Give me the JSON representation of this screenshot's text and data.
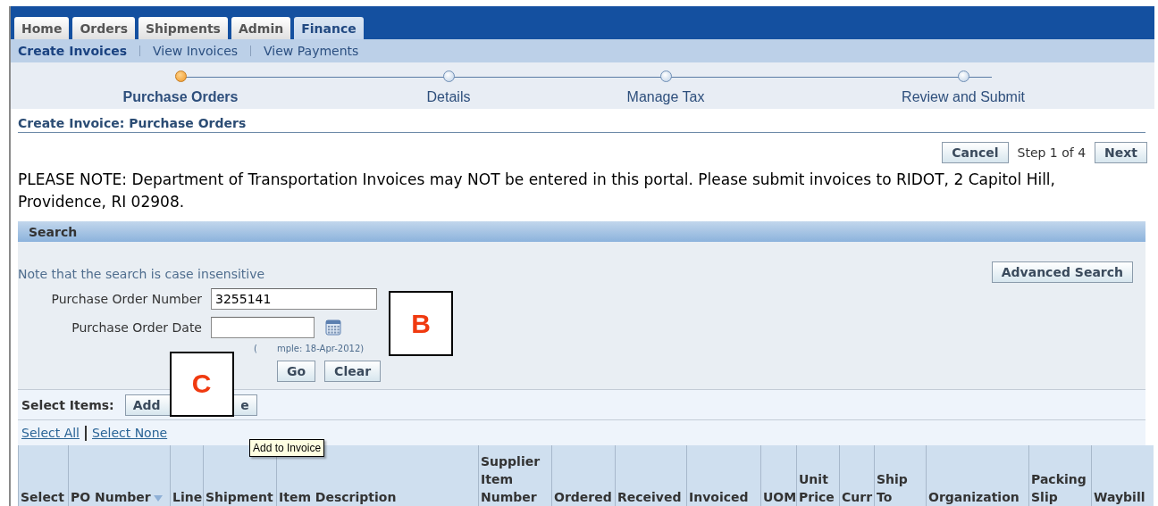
{
  "tabs": [
    {
      "label": "Home",
      "selected": false
    },
    {
      "label": "Orders",
      "selected": false
    },
    {
      "label": "Shipments",
      "selected": false
    },
    {
      "label": "Admin",
      "selected": false
    },
    {
      "label": "Finance",
      "selected": true
    }
  ],
  "subnav": [
    {
      "label": "Create Invoices",
      "selected": true
    },
    {
      "label": "View Invoices",
      "selected": false
    },
    {
      "label": "View Payments",
      "selected": false
    }
  ],
  "train": [
    {
      "label": "Purchase Orders",
      "selected": true
    },
    {
      "label": "Details",
      "selected": false
    },
    {
      "label": "Manage Tax",
      "selected": false
    },
    {
      "label": "Review and Submit",
      "selected": false
    }
  ],
  "page_title": "Create Invoice: Purchase Orders",
  "actions": {
    "cancel": "Cancel",
    "step": "Step 1 of 4",
    "next": "Next"
  },
  "notice": "PLEASE NOTE: Department of Transportation Invoices may NOT be entered in this portal. Please submit invoices to RIDOT, 2 Capitol Hill, Providence, RI 02908.",
  "search": {
    "header": "Search",
    "hint": "Note that the search is case insensitive",
    "advanced_button": "Advanced Search",
    "fields": [
      {
        "label": "Purchase Order Number",
        "value": "3255141",
        "kind": "text"
      },
      {
        "label": "Purchase Order Date",
        "kind": "date"
      }
    ],
    "example_parts": [
      "(",
      "mple: 18-Apr-2012)"
    ],
    "buttons": [
      "Go",
      "Clear"
    ]
  },
  "select_items": {
    "label": "Select Items:",
    "button_parts": [
      "Add",
      "e"
    ]
  },
  "links": [
    "Select All",
    "Select None"
  ],
  "tooltip": "Add to Invoice",
  "callouts": [
    {
      "label": "B",
      "kind": "b"
    },
    {
      "label": "C",
      "kind": "c"
    }
  ],
  "table": {
    "columns": [
      {
        "label": "Select",
        "sorted": false
      },
      {
        "label": "PO Number",
        "sorted": true
      },
      {
        "label": "Line",
        "sorted": false
      },
      {
        "label": "Shipment",
        "sorted": false
      },
      {
        "label": "Item Description",
        "sorted": false
      },
      {
        "label": "Supplier Item Number",
        "sorted": false
      },
      {
        "label": "Ordered",
        "sorted": false
      },
      {
        "label": "Received",
        "sorted": false
      },
      {
        "label": "Invoiced",
        "sorted": false
      },
      {
        "label": "UOM",
        "sorted": false
      },
      {
        "label": "Unit Price",
        "sorted": false
      },
      {
        "label": "Curr",
        "sorted": false
      },
      {
        "label": "Ship To",
        "sorted": false
      },
      {
        "label": "Organization",
        "sorted": false
      },
      {
        "label": "Packing Slip",
        "sorted": false
      },
      {
        "label": "Waybill",
        "sorted": false
      }
    ]
  }
}
